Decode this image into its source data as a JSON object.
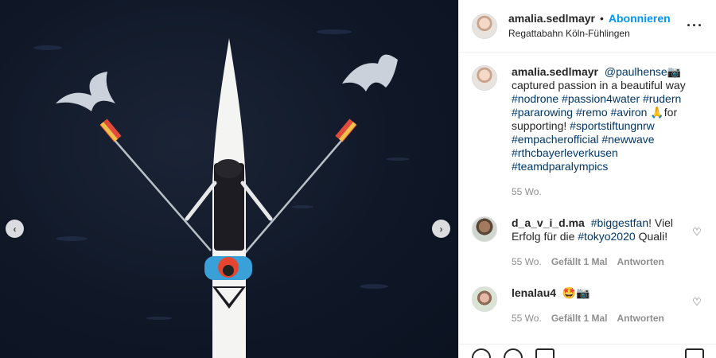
{
  "post": {
    "username": "amalia.sedlmayr",
    "follow_label": "Abonnieren",
    "separator": "•",
    "location": "Regattabahn Köln-Fühlingen",
    "more_icon": "more-horizontal-icon"
  },
  "photo": {
    "prev_icon": "chevron-left-icon",
    "next_icon": "chevron-right-icon",
    "prev_glyph": "‹",
    "next_glyph": "›"
  },
  "caption": {
    "username": "amalia.sedlmayr",
    "mention": "@paulhense",
    "emoji_1": "📷",
    "text_1": "captured passion in a beautiful way",
    "tags_line": "#nodrone #passion4water #rudern #pararowing #remo #aviron",
    "emoji_2": "🙏",
    "text_2": "for supporting!",
    "tags_end": "#sportstiftungnrw #empacherofficial #newwave #rthcbayerleverkusen #teamdparalympics",
    "time": "55 Wo."
  },
  "comments": [
    {
      "username": "d_a_v_i_d.ma",
      "tag": "#biggestfan",
      "text_1": "! Viel Erfolg für die",
      "tag_2": "#tokyo2020",
      "text_2": "Quali!",
      "time": "55 Wo.",
      "likes": "Gefällt 1 Mal",
      "reply": "Antworten"
    },
    {
      "username": "lenalau4",
      "text": "🤩📷",
      "time": "55 Wo.",
      "likes": "Gefällt 1 Mal",
      "reply": "Antworten"
    }
  ],
  "colors": {
    "accent": "#0095f6",
    "hashtag": "#00376b",
    "muted": "#8e8e8e",
    "water": "#101828"
  }
}
